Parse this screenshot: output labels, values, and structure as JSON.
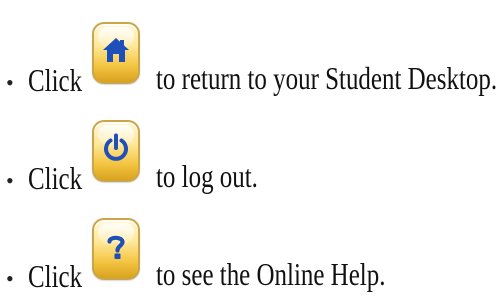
{
  "help_lines": [
    {
      "bullet": "•",
      "lead": "Click",
      "icon": "home-icon",
      "text": "to return to your Student Desktop."
    },
    {
      "bullet": "•",
      "lead": "Click",
      "icon": "power-icon",
      "text": "to log out."
    },
    {
      "bullet": "•",
      "lead": "Click",
      "icon": "help-icon",
      "text": "to see the Online Help."
    }
  ],
  "colors": {
    "icon_blue": "#1f4fb8",
    "button_gold": "#f4c542",
    "button_border": "#c9a64a"
  }
}
